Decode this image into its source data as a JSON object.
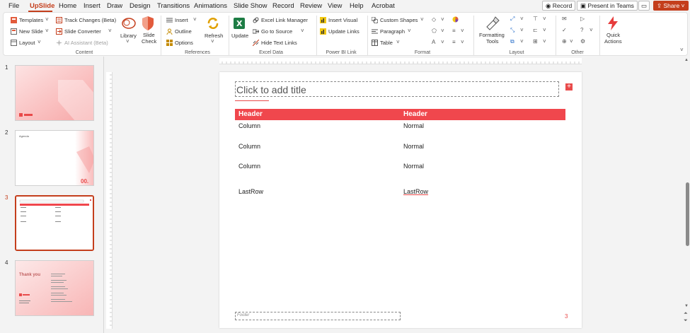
{
  "menu": {
    "items": [
      "File",
      "UpSlide",
      "Home",
      "Insert",
      "Draw",
      "Design",
      "Transitions",
      "Animations",
      "Slide Show",
      "Record",
      "Review",
      "View",
      "Help",
      "Acrobat"
    ],
    "active": "UpSlide",
    "record_label": "Record",
    "present_label": "Present in Teams",
    "share_label": "Share"
  },
  "ribbon": {
    "content": {
      "templates": "Templates",
      "new_slide": "New Slide",
      "layout": "Layout",
      "track_changes": "Track Changes (Beta)",
      "slide_converter": "Slide Converter",
      "ai_assistant": "AI Assistant (Beta)",
      "library": "Library",
      "slide_check_1": "Slide",
      "slide_check_2": "Check",
      "group": "Content"
    },
    "references": {
      "insert": "Insert",
      "outline": "Outline",
      "options": "Options",
      "refresh": "Refresh",
      "group": "References"
    },
    "excel": {
      "update": "Update",
      "excel_link_manager": "Excel Link Manager",
      "go_to_source": "Go to Source",
      "hide_text_links": "Hide Text Links",
      "group": "Excel Data"
    },
    "powerbi": {
      "insert_visual": "Insert Visual",
      "update_links": "Update Links",
      "group": "Power BI Link"
    },
    "format": {
      "custom_shapes": "Custom Shapes",
      "paragraph": "Paragraph",
      "table": "Table",
      "group": "Format"
    },
    "layout": {
      "formatting_tools_1": "Formatting",
      "formatting_tools_2": "Tools",
      "group": "Layout"
    },
    "other": {
      "group": "Other",
      "quick_1": "Quick",
      "quick_2": "Actions"
    }
  },
  "thumbnails": {
    "numbers": [
      "1",
      "2",
      "3",
      "4"
    ],
    "slide2_title": "Agenda",
    "slide2_num": "00.",
    "slide4_title": "Thank you"
  },
  "slide": {
    "title_placeholder": "Click to add title",
    "add_symbol": "+",
    "table": {
      "headers": [
        "Header",
        "Header"
      ],
      "rows": [
        [
          "Column",
          "Normal"
        ],
        [
          "Column",
          "Normal"
        ],
        [
          "Column",
          "Normal"
        ],
        [
          "LastRow",
          "LastRow"
        ]
      ]
    },
    "footer": "Footer",
    "page_number": "3"
  },
  "colors": {
    "accent": "#c43e1c",
    "table_header": "#f0474d"
  }
}
